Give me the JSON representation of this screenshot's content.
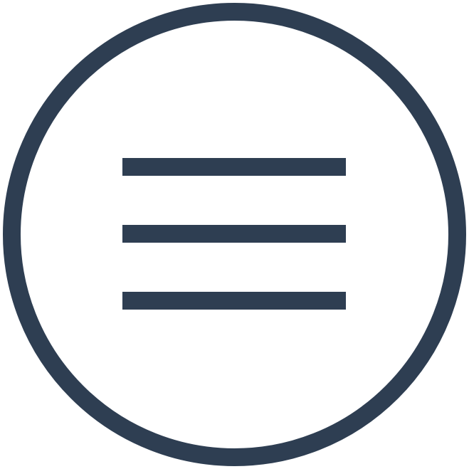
{
  "icon": {
    "name": "hamburger-menu-icon",
    "color": "#2e3e52",
    "background": "#ffffff"
  }
}
